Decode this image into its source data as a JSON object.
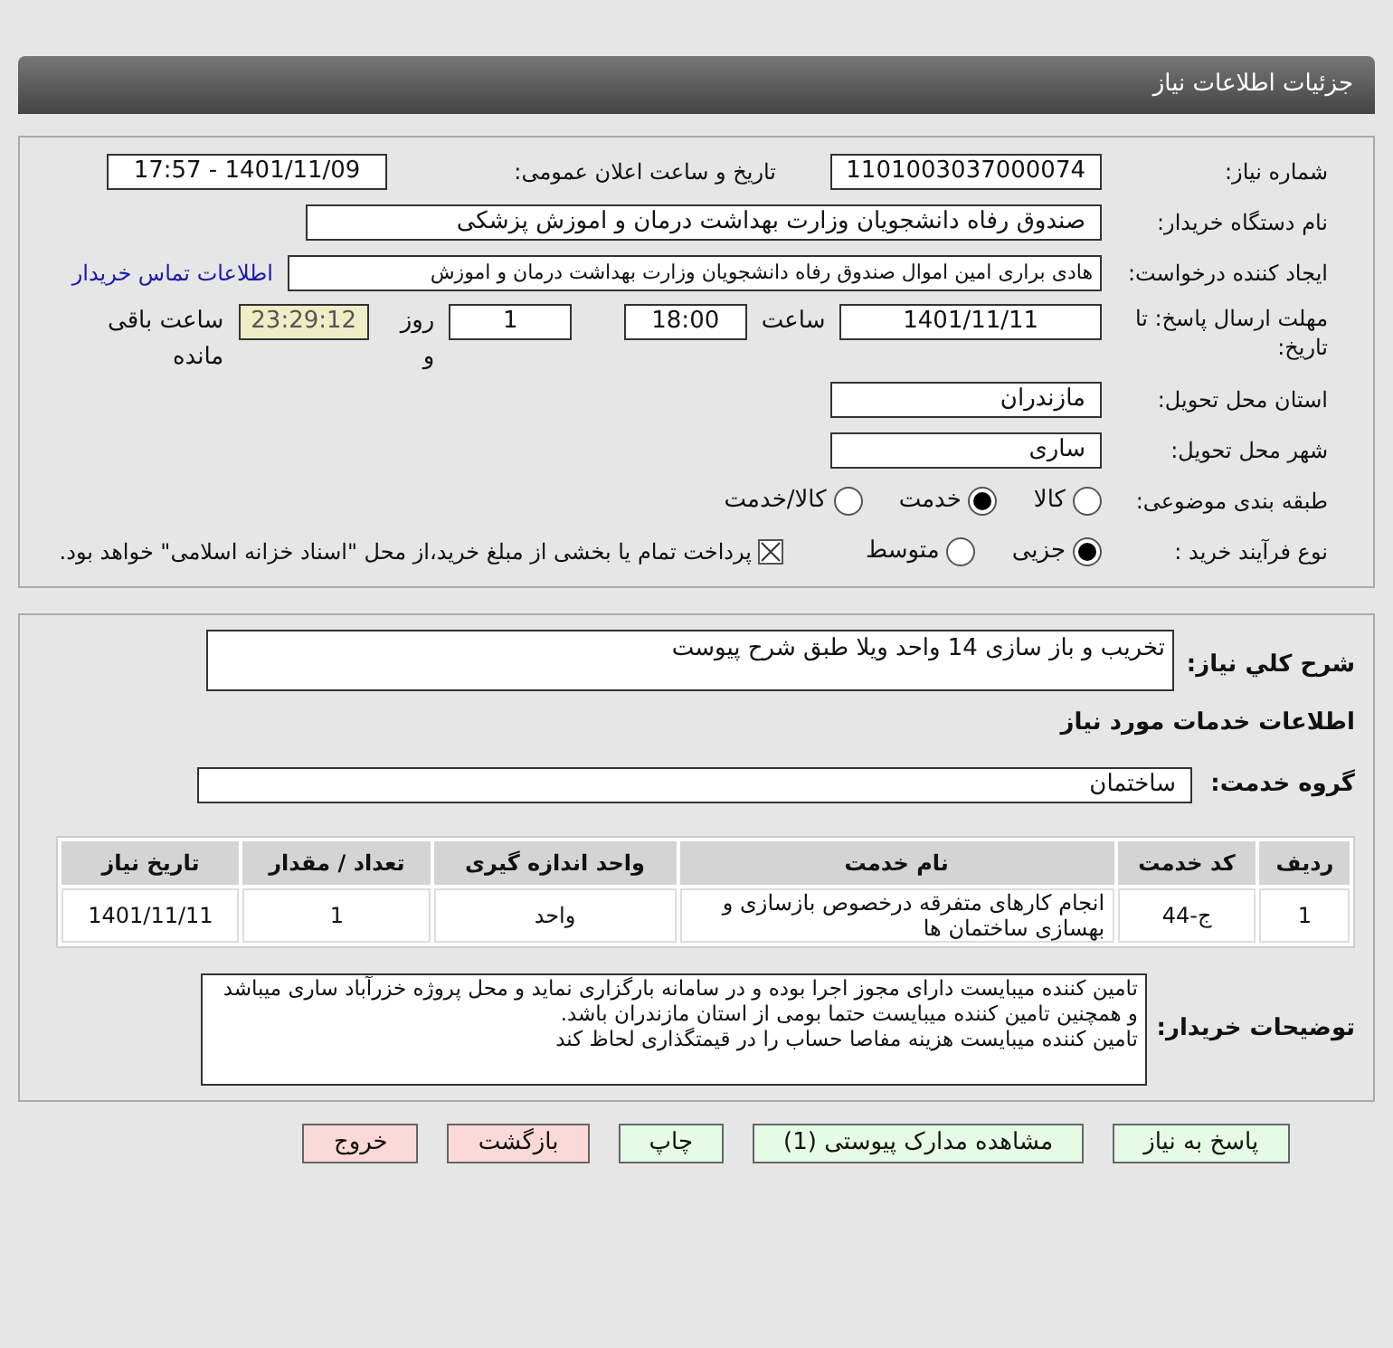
{
  "window": {
    "title": "جزئیات اطلاعات نیاز"
  },
  "fields": {
    "need_number": {
      "label": "شماره نیاز:",
      "value": "1101003037000074"
    },
    "announce": {
      "label": "تاریخ و ساعت اعلان عمومی:",
      "value": "1401/11/09 - 17:57"
    },
    "buyer": {
      "label": "نام دستگاه خریدار:",
      "value": "صندوق رفاه دانشجویان وزارت بهداشت  درمان و اموزش پزشکی"
    },
    "requester": {
      "label": "ایجاد کننده درخواست:",
      "value": "هادی براری امین اموال صندوق رفاه دانشجویان وزارت بهداشت  درمان و اموزش",
      "link": "اطلاعات تماس خریدار"
    },
    "deadline": {
      "label": "مهلت ارسال پاسخ: تا تاریخ:",
      "date": "1401/11/11",
      "time_label": "ساعت",
      "time": "18:00",
      "days": "1",
      "days_label": "روز و",
      "remaining": "23:29:12",
      "remaining_label": "ساعت باقی مانده"
    },
    "province": {
      "label": "استان محل تحویل:",
      "value": "مازندران"
    },
    "city": {
      "label": "شهر محل تحویل:",
      "value": "ساری"
    },
    "category": {
      "label": "طبقه بندی موضوعی:",
      "options": [
        {
          "label": "کالا",
          "selected": false
        },
        {
          "label": "خدمت",
          "selected": true
        },
        {
          "label": "کالا/خدمت",
          "selected": false
        }
      ]
    },
    "purchase": {
      "label": "نوع فرآیند خرید :",
      "options": [
        {
          "label": "جزیی",
          "selected": true
        },
        {
          "label": "متوسط",
          "selected": false
        }
      ],
      "payment": {
        "label": "پرداخت تمام یا بخشی از مبلغ خرید،از محل \"اسناد خزانه اسلامی\" خواهد بود.",
        "checked": true
      }
    }
  },
  "summary": {
    "label": "شرح کلي نياز:",
    "value": "تخریب و باز سازی 14 واحد ویلا طبق شرح پیوست"
  },
  "services_heading": "اطلاعات خدمات مورد نیاز",
  "service_group": {
    "label": "گروه خدمت:",
    "value": "ساختمان"
  },
  "table": {
    "columns": [
      "ردیف",
      "کد خدمت",
      "نام خدمت",
      "واحد اندازه گیری",
      "تعداد / مقدار",
      "تاریخ نیاز"
    ],
    "rows": [
      [
        "1",
        "ج-44",
        "انجام کارهای متفرقه درخصوص بازسازی و بهسازی ساختمان ها",
        "واحد",
        "1",
        "1401/11/11"
      ]
    ]
  },
  "notes": {
    "label": "توضیحات خریدار:",
    "lines": [
      "تامین کننده میبایست دارای مجوز اجرا بوده  و در سامانه بارگزاری نماید و محل پروژه خزرآباد ساری میباشد و همچنین تامین کننده میبایست حتما بومی از استان مازندران باشد.",
      "تامین کننده میبایست هزینه مفاصا حساب را در قیمتگذاری لحاظ کند"
    ]
  },
  "buttons": [
    {
      "label": "پاسخ به نیاز",
      "kind": "action"
    },
    {
      "label": "مشاهده مدارک پیوستی (1)",
      "kind": "action"
    },
    {
      "label": "چاپ",
      "kind": "action"
    },
    {
      "label": "بازگشت",
      "kind": "exit"
    },
    {
      "label": "خروج",
      "kind": "exit"
    }
  ]
}
